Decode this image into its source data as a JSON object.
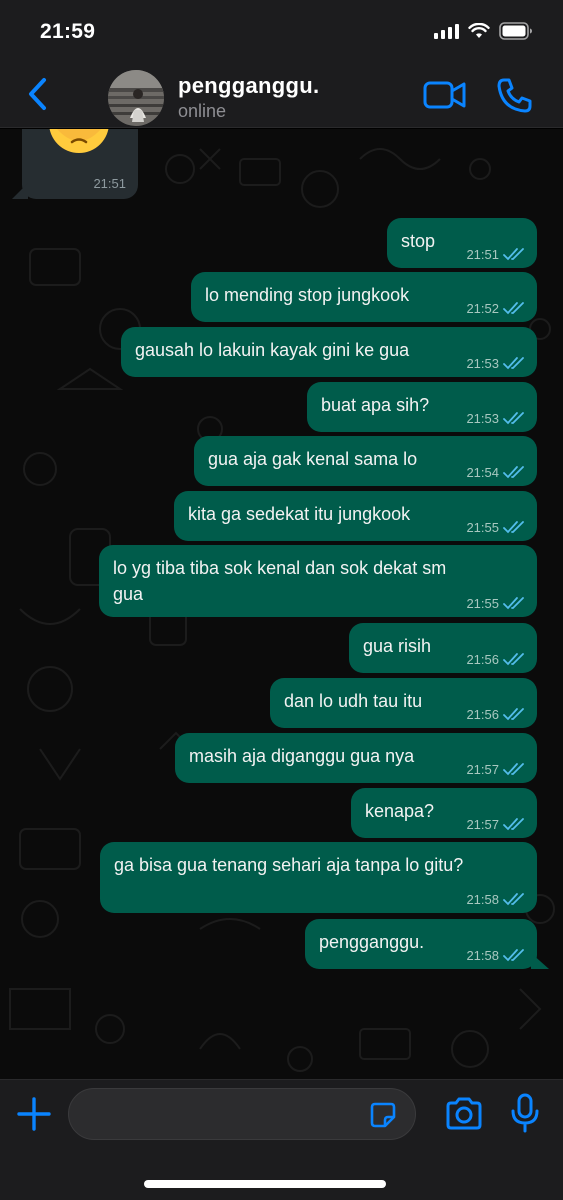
{
  "status_bar": {
    "time": "21:59"
  },
  "header": {
    "contact_name": "pengganggu.",
    "contact_status": "online"
  },
  "incoming": {
    "emoji": "pleading-face",
    "time": "21:51"
  },
  "messages": [
    {
      "text": "stop",
      "time": "21:51"
    },
    {
      "text": "lo mending stop jungkook",
      "time": "21:52"
    },
    {
      "text": "gausah lo lakuin kayak gini ke gua",
      "time": "21:53"
    },
    {
      "text": "buat apa sih?",
      "time": "21:53"
    },
    {
      "text": "gua aja gak kenal sama lo",
      "time": "21:54"
    },
    {
      "text": "kita ga sedekat itu jungkook",
      "time": "21:55"
    },
    {
      "line1": "lo yg tiba tiba sok kenal dan sok dekat sm",
      "line2": "gua",
      "time": "21:55"
    },
    {
      "text": "gua risih",
      "time": "21:56"
    },
    {
      "text": "dan lo udh tau itu",
      "time": "21:56"
    },
    {
      "text": "masih aja diganggu gua nya",
      "time": "21:57"
    },
    {
      "text": "kenapa?",
      "time": "21:57"
    },
    {
      "text": "ga bisa gua tenang sehari aja tanpa lo gitu?",
      "time": "21:58"
    },
    {
      "text": "pengganggu.",
      "time": "21:58"
    }
  ],
  "input": {
    "placeholder": "",
    "value": ""
  },
  "colors": {
    "accent": "#0a84ff",
    "outgoing_bubble": "#005c4b",
    "read_ticks": "#53bdeb"
  },
  "icons": [
    "back-chevron-icon",
    "video-call-icon",
    "phone-icon",
    "plus-icon",
    "sticker-icon",
    "camera-icon",
    "microphone-icon"
  ]
}
